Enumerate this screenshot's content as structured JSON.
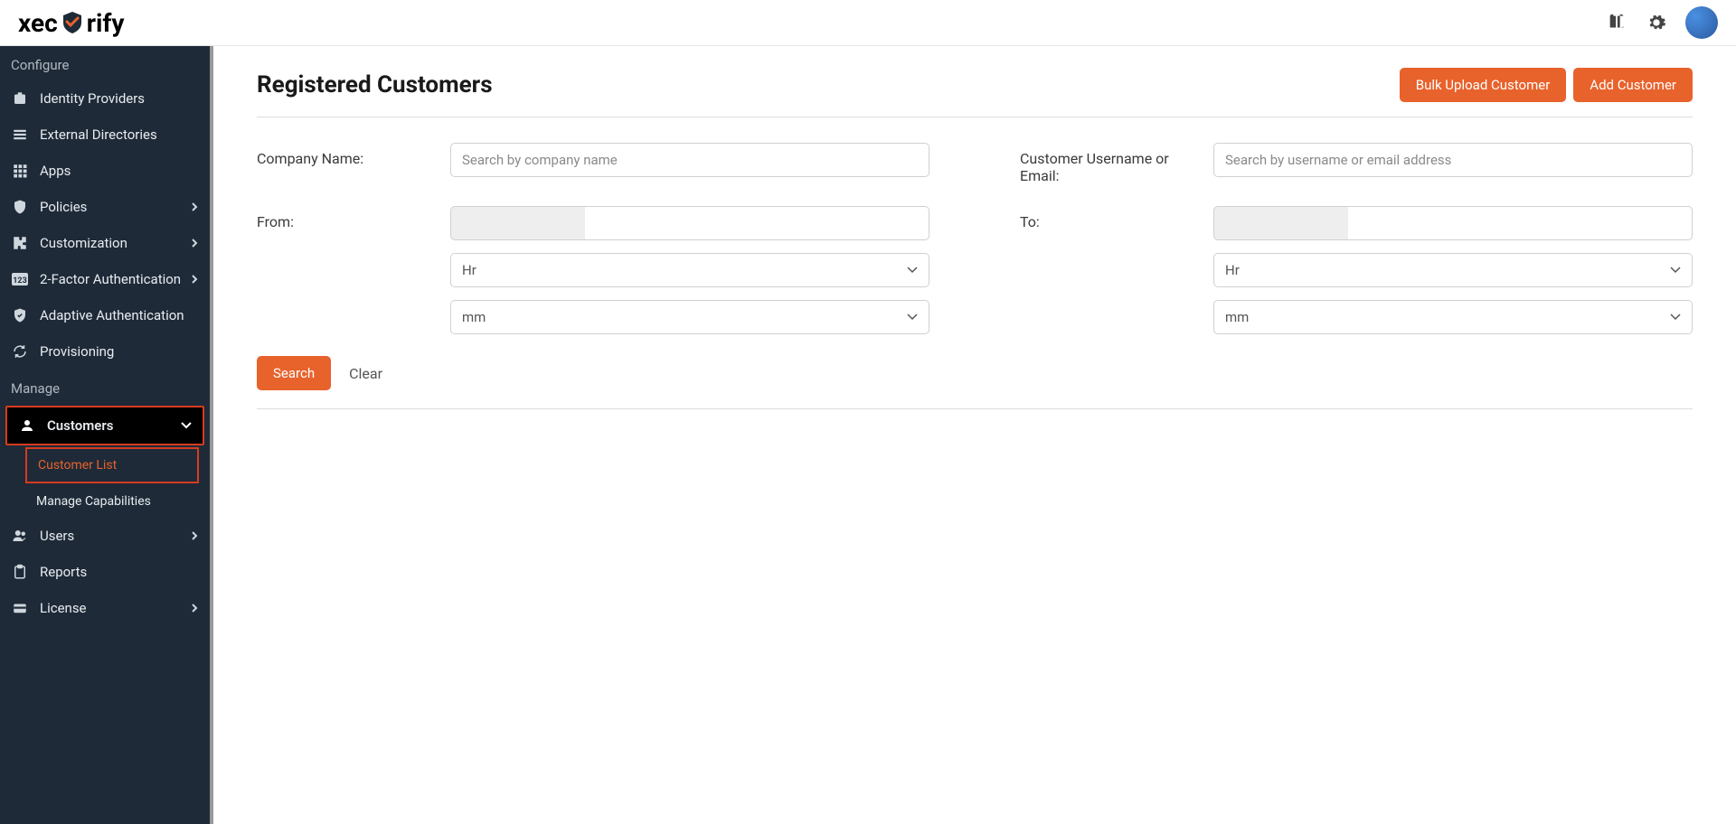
{
  "logo": {
    "part1": "xec",
    "part2": "rify"
  },
  "sidebar": {
    "section_configure": "Configure",
    "section_manage": "Manage",
    "identity_providers": "Identity Providers",
    "external_directories": "External Directories",
    "apps": "Apps",
    "policies": "Policies",
    "customization": "Customization",
    "two_factor": "2-Factor Authentication",
    "adaptive_auth": "Adaptive Authentication",
    "provisioning": "Provisioning",
    "customers": "Customers",
    "customer_list": "Customer List",
    "manage_capabilities": "Manage Capabilities",
    "users": "Users",
    "reports": "Reports",
    "license": "License"
  },
  "page": {
    "title": "Registered Customers",
    "bulk_upload": "Bulk Upload Customer",
    "add_customer": "Add Customer"
  },
  "filters": {
    "company_label": "Company Name:",
    "company_placeholder": "Search by company name",
    "username_label": "Customer Username or Email:",
    "username_placeholder": "Search by username or email address",
    "from_label": "From:",
    "to_label": "To:",
    "hr_option": "Hr",
    "mm_option": "mm",
    "search": "Search",
    "clear": "Clear"
  }
}
